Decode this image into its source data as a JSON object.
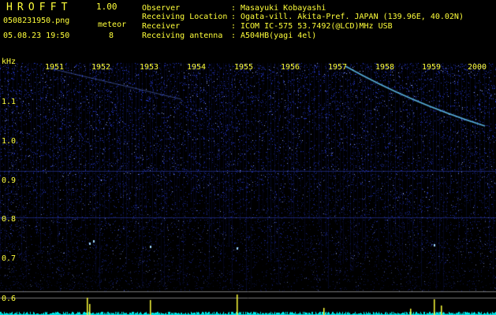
{
  "app": {
    "title": "HROFFT",
    "version": "1.00",
    "filename": "0508231950.png",
    "datetime": "05.08.23 19:50",
    "meteor_label": "meteor",
    "meteor_count": "8"
  },
  "info": [
    {
      "label": "Observer",
      "colon": ":",
      "value": "Masayuki Kobayashi"
    },
    {
      "label": "Receiving Location",
      "colon": ":",
      "value": "Ogata-vill. Akita-Pref. JAPAN (139.96E, 40.02N)"
    },
    {
      "label": "Receiver",
      "colon": ":",
      "value": "ICOM IC-575 53.7492(@LCD)MHz USB"
    },
    {
      "label": "Receiving antenna",
      "colon": ":",
      "value": "A504HB(yagi 4el)"
    }
  ],
  "axes": {
    "y_unit": "kHz",
    "y_ticks": [
      "1.1",
      "1.0",
      "0.9",
      "0.8",
      "0.7",
      "0.6"
    ],
    "x_ticks": [
      "1951",
      "1952",
      "1953",
      "1954",
      "1955",
      "1956",
      "1957",
      "1958",
      "1959",
      "2000"
    ]
  },
  "colors": {
    "text": "#ffff3a",
    "background": "#000000",
    "noise": "#1e2cc8",
    "trace": "#66ccff",
    "spectrum": "#00e5e5",
    "meteor_spike": "#ffff3a"
  }
}
